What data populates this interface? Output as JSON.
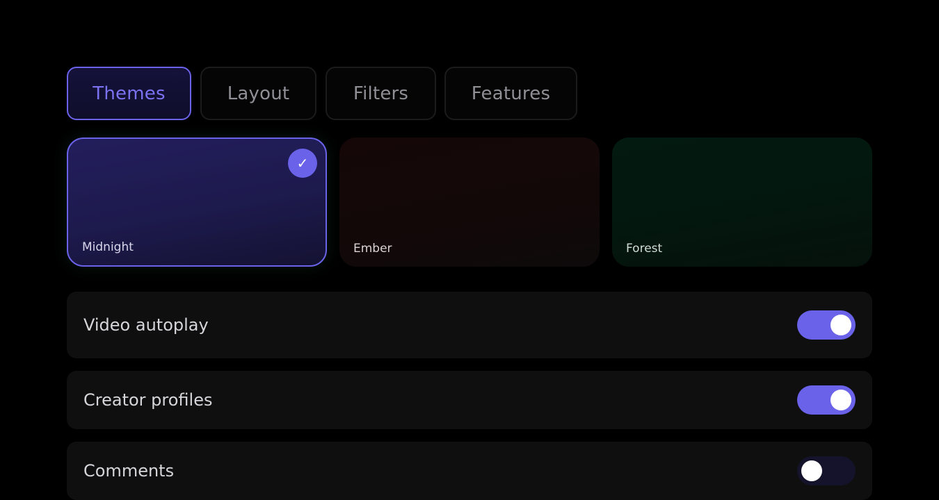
{
  "tabs": [
    {
      "label": "Themes",
      "active": true
    },
    {
      "label": "Layout",
      "active": false
    },
    {
      "label": "Filters",
      "active": false
    },
    {
      "label": "Features",
      "active": false
    }
  ],
  "themes": [
    {
      "label": "Midnight",
      "selected": true,
      "check": "✓"
    },
    {
      "label": "Ember",
      "selected": false
    },
    {
      "label": "Forest",
      "selected": false
    }
  ],
  "settings": [
    {
      "label": "Video autoplay",
      "enabled": true
    },
    {
      "label": "Creator profiles",
      "enabled": true
    },
    {
      "label": "Comments",
      "enabled": false
    }
  ],
  "colors": {
    "accent": "#6a62e8",
    "background": "#000000",
    "row_background": "#0f0f10"
  }
}
